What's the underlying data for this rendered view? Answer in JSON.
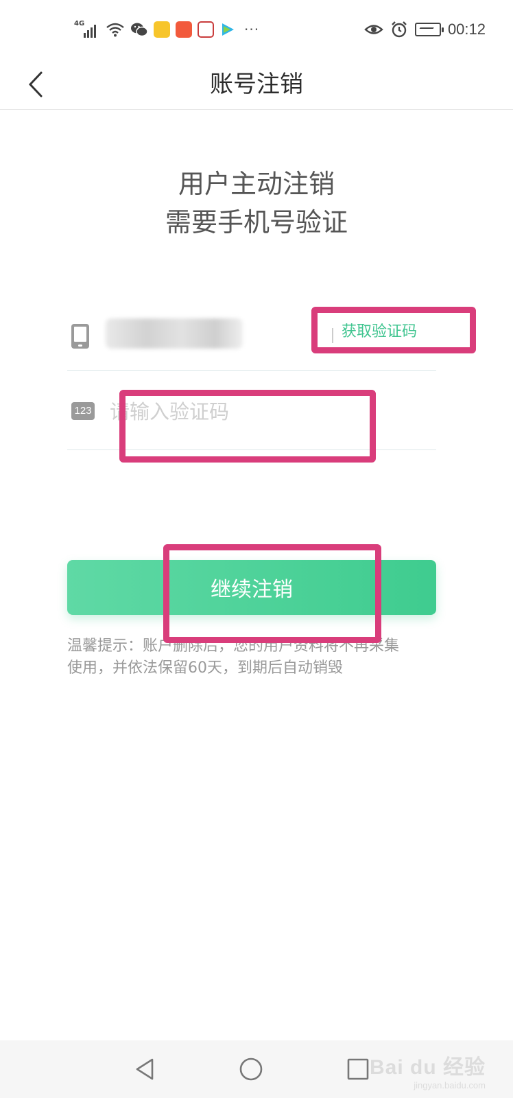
{
  "status_bar": {
    "network": "4G",
    "time": "00:12",
    "more": "···",
    "icons": [
      "signal-icon",
      "wifi-icon",
      "wechat-icon",
      "sohu-icon",
      "kuaishou-icon",
      "xuexi-icon",
      "tencent-video-icon",
      "eye-icon",
      "alarm-icon",
      "battery-icon"
    ]
  },
  "nav": {
    "title": "账号注销"
  },
  "headline": {
    "line1": "用户主动注销",
    "line2": "需要手机号验证"
  },
  "phone_field": {
    "get_code_label": "获取验证码"
  },
  "code_field": {
    "icon_text": "123",
    "placeholder": "请输入验证码"
  },
  "primary_button": {
    "label": "继续注销"
  },
  "tip": {
    "line1": "温馨提示：账户删除后，您的用户资料将不再采集",
    "line2": "使用，并依法保留60天，到期后自动销毁"
  },
  "watermark": {
    "logo": "Bai du 经验",
    "url": "jingyan.baidu.com"
  },
  "colors": {
    "accent": "#3fcc8f",
    "highlight": "#d93d7b",
    "tip_text": "#999999"
  }
}
